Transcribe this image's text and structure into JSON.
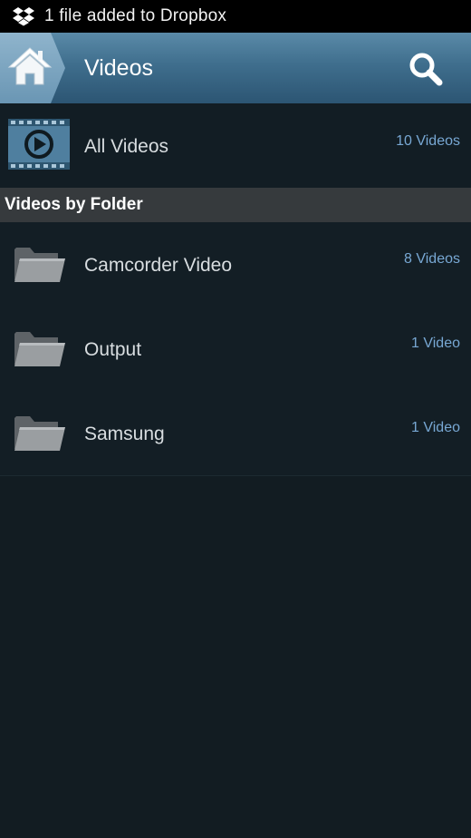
{
  "status_bar": {
    "icon": "dropbox-icon",
    "message": "1 file added to Dropbox"
  },
  "action_bar": {
    "home_icon": "home-icon",
    "title": "Videos",
    "search_icon": "search-icon"
  },
  "all_videos": {
    "icon": "film-play-icon",
    "label": "All Videos",
    "count": "10 Videos"
  },
  "section": {
    "title": "Videos by Folder"
  },
  "folders": [
    {
      "icon": "folder-icon",
      "label": "Camcorder Video",
      "count": "8 Videos"
    },
    {
      "icon": "folder-icon",
      "label": "Output",
      "count": "1 Video"
    },
    {
      "icon": "folder-icon",
      "label": "Samsung",
      "count": "1 Video"
    }
  ],
  "colors": {
    "background": "#121c22",
    "action_bar": "#3f6e8d",
    "count_text": "#78a8d4",
    "section_header": "#363a3d"
  }
}
